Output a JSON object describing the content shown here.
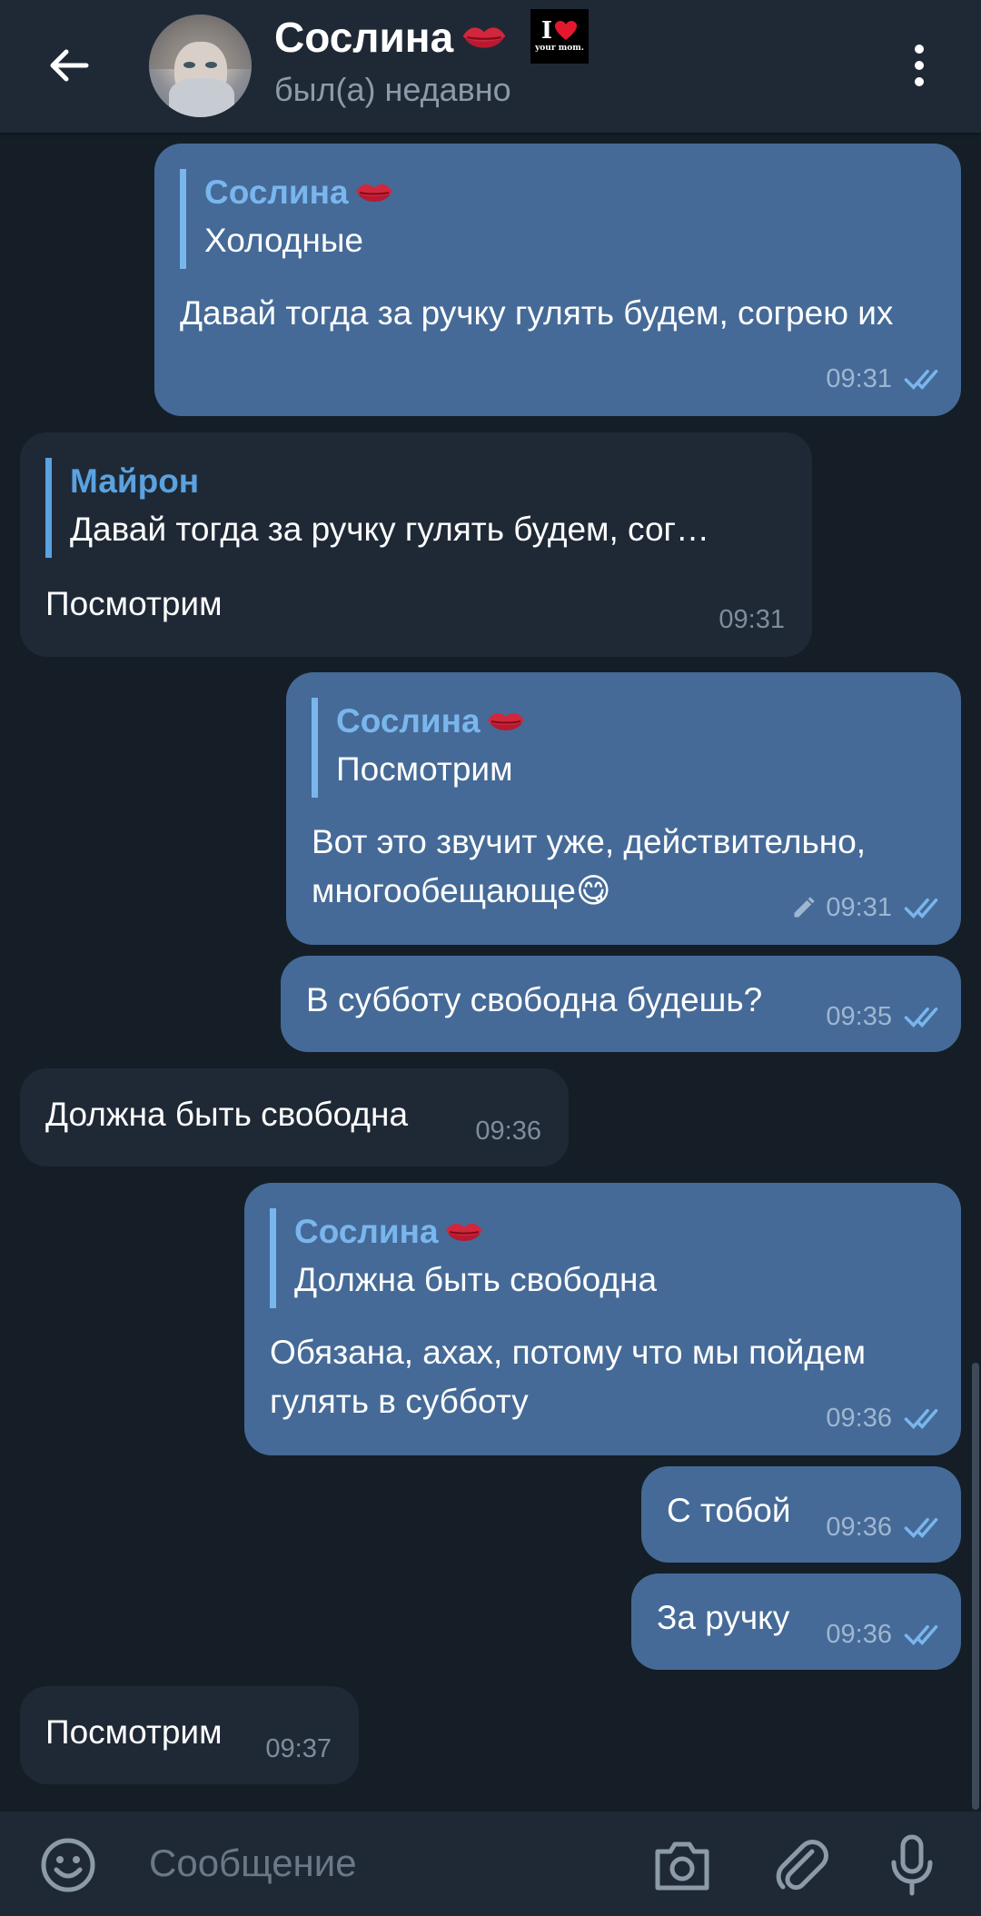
{
  "header": {
    "contact_name": "Сослина",
    "status": "был(а) недавно",
    "badge": {
      "line1": "I",
      "line2": "your mom."
    }
  },
  "messages": [
    {
      "direction": "out",
      "reply": {
        "name": "Сослина",
        "text": "Холодные"
      },
      "text": "Давай тогда за ручку гулять будем, согрею их",
      "time": "09:31",
      "read": true
    },
    {
      "direction": "in",
      "reply": {
        "name": "Майрон",
        "text": "Давай тогда за ручку гулять будем, сог…"
      },
      "text": "Посмотрим",
      "time": "09:31"
    },
    {
      "direction": "out",
      "reply": {
        "name": "Сослина",
        "text": "Посмотрим"
      },
      "text": "Вот это звучит уже, действительно, многообещающе😋",
      "time": "09:31",
      "edited": true,
      "read": true
    },
    {
      "direction": "out",
      "text": "В субботу свободна будешь?",
      "time": "09:35",
      "read": true
    },
    {
      "direction": "in",
      "text": "Должна быть свободна",
      "time": "09:36"
    },
    {
      "direction": "out",
      "reply": {
        "name": "Сослина",
        "text": "Должна быть свободна"
      },
      "text": "Обязана, ахах, потому что мы пойдем гулять в субботу",
      "time": "09:36",
      "read": true
    },
    {
      "direction": "out",
      "text": "С тобой",
      "time": "09:36",
      "read": true
    },
    {
      "direction": "out",
      "text": "За ручку",
      "time": "09:36",
      "read": true
    },
    {
      "direction": "in",
      "text": "Посмотрим",
      "time": "09:37"
    }
  ],
  "composer": {
    "placeholder": "Сообщение"
  },
  "colors": {
    "background": "#151e27",
    "header": "#1f2936",
    "outgoing_bubble": "#456a97",
    "incoming_bubble": "#1f2936",
    "reply_accent": "#7ab6ee",
    "read_ticks": "#7ab6ee"
  },
  "icons": [
    "back-arrow-icon",
    "kiss-lips-icon",
    "heart-icon",
    "more-vertical-icon",
    "edit-pencil-icon",
    "double-check-icon",
    "emoji-icon",
    "camera-icon",
    "paperclip-icon",
    "microphone-icon"
  ]
}
